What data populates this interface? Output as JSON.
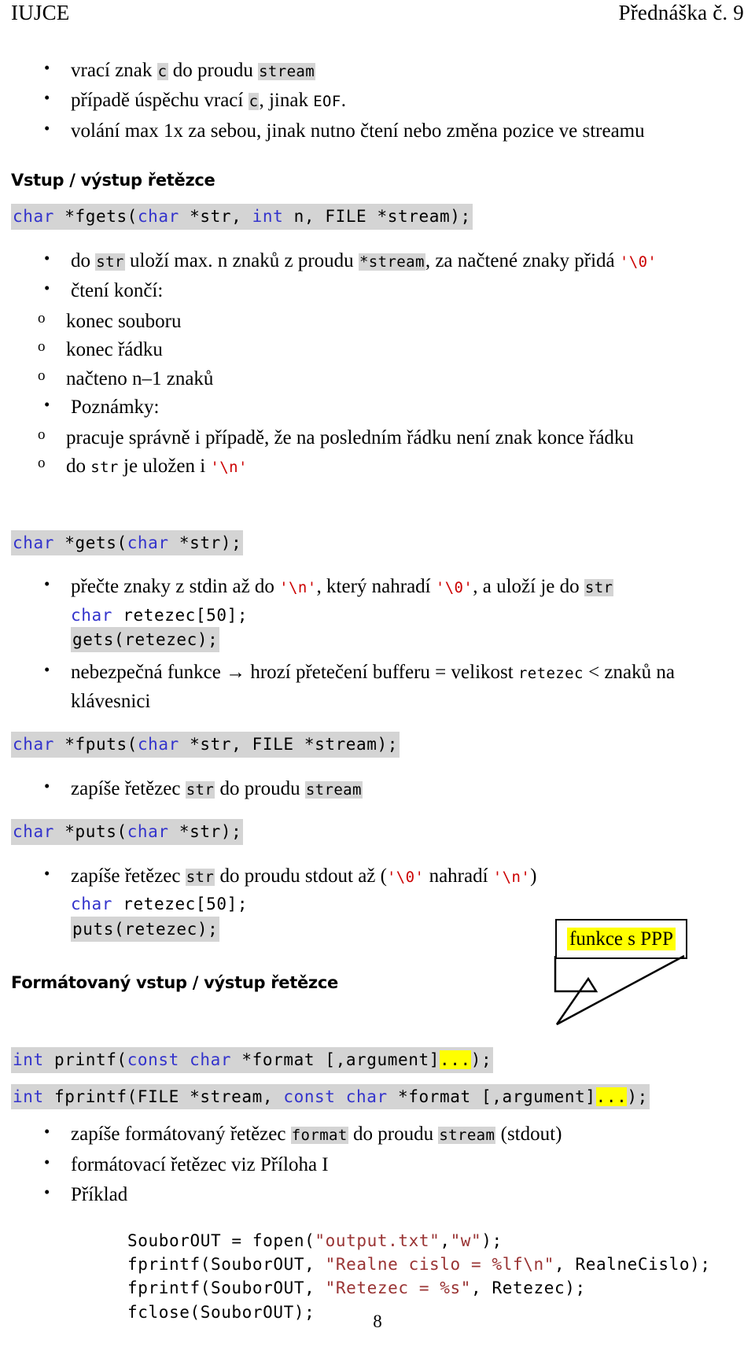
{
  "header": {
    "left": "IUJCE",
    "right": "Přednáška č. 9"
  },
  "intro_bullets": {
    "b1_a": "vrací znak ",
    "b1_code": "c",
    "b1_b": " do proudu ",
    "b1_code2": "stream",
    "b2_a": "případě úspěchu vrací ",
    "b2_code": "c",
    "b2_b": ", jinak ",
    "b2_code2": "EOF",
    "b2_c": ".",
    "b3": "volání max 1x za sebou, jinak nutno čtení nebo změna pozice ve streamu"
  },
  "section_strings": {
    "heading": "Vstup / výstup řetězce",
    "fgets_sig": {
      "kw1": "char",
      "mid1": " *fgets(",
      "kw2": "char",
      "mid2": " *str, ",
      "kw3": "int",
      "mid3": " n, FILE *stream);"
    },
    "fgets_bullets": {
      "b1_a": "do ",
      "b1_code": "str",
      "b1_b": " uloží max. n znaků z proudu ",
      "b1_code2": "*stream",
      "b1_c": ", za načtené znaky přidá ",
      "b1_esc": "'\\0'",
      "b2": "čtení končí:",
      "s1": "konec souboru",
      "s2": "konec řádku",
      "s3": "načteno n–1 znaků",
      "b3": "Poznámky:",
      "s4": "pracuje správně i případě, že na posledním řádku není znak konce řádku",
      "s5_a": "do ",
      "s5_code": "str",
      "s5_b": " je uložen i ",
      "s5_esc": "'\\n'"
    },
    "gets_sig": {
      "kw1": "char",
      "mid1": " *gets(",
      "kw2": "char",
      "mid2": " *str);"
    },
    "gets_bullets": {
      "b1_a": "přečte znaky z stdin až do ",
      "b1_esc1": "'\\n'",
      "b1_b": ", který nahradí ",
      "b1_esc2": "'\\0'",
      "b1_c": ", a uloží je do ",
      "b1_code": "str",
      "code1_kw": "char",
      "code1_rest": " retezec[50];",
      "code2": "gets(retezec);",
      "b2_a": "nebezpečná funkce → hrozí přetečení bufferu = velikost ",
      "b2_code": "retezec",
      "b2_b": " < znaků na klávesnici"
    },
    "fputs_sig": {
      "kw1": "char",
      "mid1": " *fputs(",
      "kw2": "char",
      "mid2": " *str, FILE *stream);"
    },
    "fputs_bullets": {
      "b1_a": "zapíše řetězec ",
      "b1_code": "str",
      "b1_b": " do proudu ",
      "b1_code2": "stream"
    },
    "puts_sig": {
      "kw1": "char",
      "mid1": " *puts(",
      "kw2": "char",
      "mid2": " *str);"
    },
    "puts_bullets": {
      "b1_a": "zapíše řetězec ",
      "b1_code": "str",
      "b1_b": " do proudu stdout až (",
      "b1_esc1": "'\\0'",
      "b1_c": " nahradí ",
      "b1_esc2": "'\\n'",
      "b1_d": ")",
      "code1_kw": "char",
      "code1_rest": " retezec[50];",
      "code2": "puts(retezec);"
    }
  },
  "section_formatted": {
    "heading": "Formátovaný vstup / výstup řetězce",
    "callout": "funkce s PPP",
    "printf_sig": {
      "kw1": "int",
      "mid1": " printf(",
      "kw2": "const",
      "mid2": " ",
      "kw3": "char",
      "mid3": " *format [,argument]",
      "hl": "...",
      "mid4": ");"
    },
    "fprintf_sig": {
      "kw1": "int",
      "mid1": " fprintf(FILE *stream, ",
      "kw2": "const",
      "mid2": " ",
      "kw3": "char",
      "mid3": " *format [,argument]",
      "hl": "...",
      "mid4": ");"
    },
    "bullets": {
      "b1_a": "zapíše formátovaný řetězec ",
      "b1_code": "format",
      "b1_b": " do proudu ",
      "b1_code2": "stream",
      "b1_c": " (stdout)",
      "b2": "formátovací řetězec viz Příloha I",
      "b3": "Příklad"
    },
    "example": {
      "l1_a": "SouborOUT = fopen(",
      "l1_s1": "\"output.txt\"",
      "l1_b": ",",
      "l1_s2": "\"w\"",
      "l1_c": ");",
      "l2_a": "fprintf(SouborOUT, ",
      "l2_s": "\"Realne cislo = %lf\\n\"",
      "l2_b": ", RealneCislo);",
      "l3_a": "fprintf(SouborOUT, ",
      "l3_s": "\"Retezec = %s\"",
      "l3_b": ", Retezec);",
      "l4": "fclose(SouborOUT);"
    }
  },
  "footer": {
    "page_number": "8"
  }
}
